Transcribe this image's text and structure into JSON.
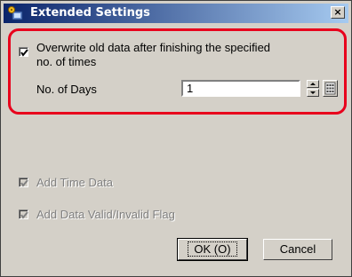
{
  "window": {
    "title": "Extended Settings",
    "close_label": "×"
  },
  "overwrite": {
    "label_line1": "Overwrite old data after finishing the specified",
    "label_line2": "no. of times",
    "checked": true,
    "days_label": "No. of Days",
    "days_value": "1"
  },
  "options": {
    "add_time_data": "Add Time Data",
    "add_valid_flag": "Add Data Valid/Invalid Flag"
  },
  "buttons": {
    "ok": "OK (O)",
    "cancel": "Cancel"
  },
  "colors": {
    "highlight": "#e8001c",
    "titlebar_start": "#0a246a",
    "titlebar_end": "#a6caf0"
  }
}
